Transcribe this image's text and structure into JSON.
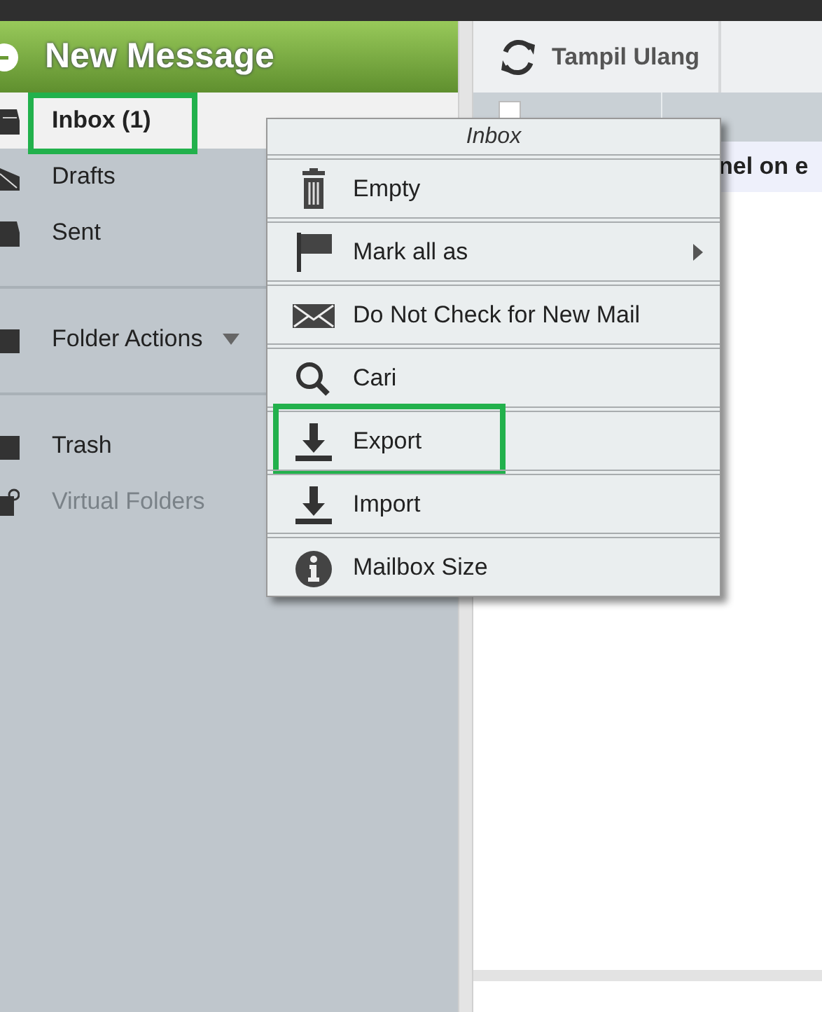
{
  "sidebar": {
    "new_message": {
      "label": "New Message"
    },
    "folder_groups": [
      [
        {
          "label": "Inbox (1)",
          "selected": true,
          "highlighted": true,
          "disabled": false
        },
        {
          "label": "Drafts",
          "selected": false,
          "highlighted": false,
          "disabled": false
        },
        {
          "label": "Sent",
          "selected": false,
          "highlighted": false,
          "disabled": false
        }
      ],
      [
        {
          "label": "Folder Actions",
          "selected": false,
          "highlighted": false,
          "disabled": false,
          "dropdown": true
        }
      ],
      [
        {
          "label": "Trash",
          "selected": false,
          "highlighted": false,
          "disabled": false
        },
        {
          "label": "Virtual Folders",
          "selected": false,
          "highlighted": false,
          "disabled": true
        }
      ]
    ]
  },
  "toolbar": {
    "buttons": [
      {
        "label": "Tampil Ulang"
      }
    ]
  },
  "message_list": {
    "select_all": {
      "checked": false
    },
    "rows": [
      {
        "text": "nel on e"
      }
    ]
  },
  "context_menu": {
    "title": "Inbox",
    "items": [
      {
        "label": "Empty",
        "submenu": false,
        "highlighted": false
      },
      {
        "label": "Mark all as",
        "submenu": true,
        "highlighted": false
      },
      {
        "label": "Do Not Check for New Mail",
        "submenu": false,
        "highlighted": false
      },
      {
        "label": "Cari",
        "submenu": false,
        "highlighted": false
      },
      {
        "label": "Export",
        "submenu": false,
        "highlighted": true
      },
      {
        "label": "Import",
        "submenu": false,
        "highlighted": false
      },
      {
        "label": "Mailbox Size",
        "submenu": false,
        "highlighted": false
      }
    ]
  }
}
